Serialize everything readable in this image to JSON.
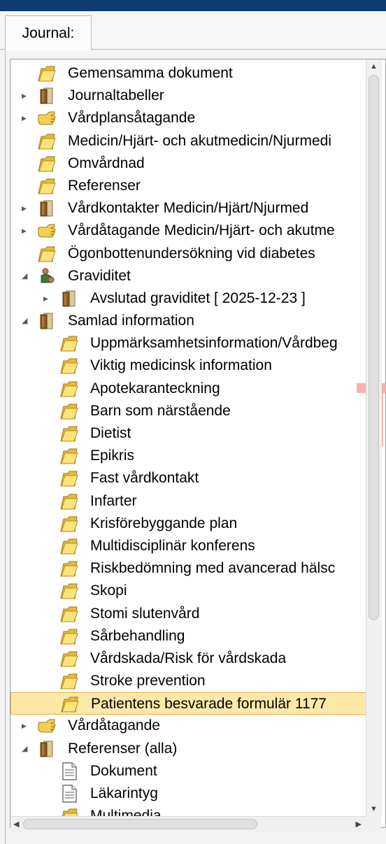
{
  "tab": {
    "label": "Journal:"
  },
  "tree": {
    "items": [
      {
        "label": "Gemensamma dokument",
        "level": 0,
        "expander": "none",
        "icon": "folder-icon"
      },
      {
        "label": "Journaltabeller",
        "level": 0,
        "expander": "collapsed",
        "icon": "binder-icon"
      },
      {
        "label": "Vårdplansåtagande",
        "level": 0,
        "expander": "collapsed",
        "icon": "hand-icon"
      },
      {
        "label": "Medicin/Hjärt- och akutmedicin/Njurmedi",
        "level": 0,
        "expander": "none",
        "icon": "folder-icon"
      },
      {
        "label": "Omvårdnad",
        "level": 0,
        "expander": "none",
        "icon": "folder-icon"
      },
      {
        "label": "Referenser",
        "level": 0,
        "expander": "none",
        "icon": "folder-icon"
      },
      {
        "label": "Vårdkontakter Medicin/Hjärt/Njurmed",
        "level": 0,
        "expander": "collapsed",
        "icon": "binder-icon"
      },
      {
        "label": "Vårdåtagande Medicin/Hjärt- och akutme",
        "level": 0,
        "expander": "collapsed",
        "icon": "hand-icon"
      },
      {
        "label": "Ögonbottenundersökning vid diabetes",
        "level": 0,
        "expander": "none",
        "icon": "folder-icon"
      },
      {
        "label": "Graviditet",
        "level": 0,
        "expander": "expanded",
        "icon": "pregnancy-icon"
      },
      {
        "label": "Avslutad graviditet [ 2025-12-23 ]",
        "level": 1,
        "expander": "collapsed",
        "icon": "binder-icon"
      },
      {
        "label": "Samlad information",
        "level": 0,
        "expander": "expanded",
        "icon": "binder-icon"
      },
      {
        "label": "Uppmärksamhetsinformation/Vårdbeg",
        "level": 1,
        "expander": "none",
        "icon": "folder-icon"
      },
      {
        "label": "Viktig medicinsk information",
        "level": 1,
        "expander": "none",
        "icon": "folder-icon"
      },
      {
        "label": "Apotekaranteckning",
        "level": 1,
        "expander": "none",
        "icon": "folder-icon"
      },
      {
        "label": "Barn som närstående",
        "level": 1,
        "expander": "none",
        "icon": "folder-icon"
      },
      {
        "label": "Dietist",
        "level": 1,
        "expander": "none",
        "icon": "folder-icon"
      },
      {
        "label": "Epikris",
        "level": 1,
        "expander": "none",
        "icon": "folder-icon"
      },
      {
        "label": "Fast vårdkontakt",
        "level": 1,
        "expander": "none",
        "icon": "folder-icon"
      },
      {
        "label": "Infarter",
        "level": 1,
        "expander": "none",
        "icon": "folder-icon"
      },
      {
        "label": "Krisförebyggande plan",
        "level": 1,
        "expander": "none",
        "icon": "folder-icon"
      },
      {
        "label": "Multidisciplinär konferens",
        "level": 1,
        "expander": "none",
        "icon": "folder-icon"
      },
      {
        "label": "Riskbedömning med avancerad hälsc",
        "level": 1,
        "expander": "none",
        "icon": "folder-icon"
      },
      {
        "label": "Skopi",
        "level": 1,
        "expander": "none",
        "icon": "folder-icon"
      },
      {
        "label": "Stomi slutenvård",
        "level": 1,
        "expander": "none",
        "icon": "folder-icon"
      },
      {
        "label": "Sårbehandling",
        "level": 1,
        "expander": "none",
        "icon": "folder-icon"
      },
      {
        "label": "Vårdskada/Risk för vårdskada",
        "level": 1,
        "expander": "none",
        "icon": "folder-icon"
      },
      {
        "label": "Stroke prevention",
        "level": 1,
        "expander": "none",
        "icon": "folder-icon"
      },
      {
        "label": "Patientens besvarade formulär 1177",
        "level": 1,
        "expander": "none",
        "icon": "folder-icon",
        "selected": true
      },
      {
        "label": "Vårdåtagande",
        "level": 0,
        "expander": "collapsed",
        "icon": "hand-icon"
      },
      {
        "label": "Referenser (alla)",
        "level": 0,
        "expander": "expanded",
        "icon": "binder-icon"
      },
      {
        "label": "Dokument",
        "level": 1,
        "expander": "none",
        "icon": "document-icon"
      },
      {
        "label": "Läkarintyg",
        "level": 1,
        "expander": "none",
        "icon": "document-icon"
      },
      {
        "label": "Multimedia",
        "level": 1,
        "expander": "none",
        "icon": "folder-icon"
      }
    ]
  },
  "colors": {
    "title_bar": "#0d3d73",
    "selection_fill": "#fde9a6",
    "selection_border": "#e8b04a",
    "folder_yellow": "#f6d35a"
  }
}
